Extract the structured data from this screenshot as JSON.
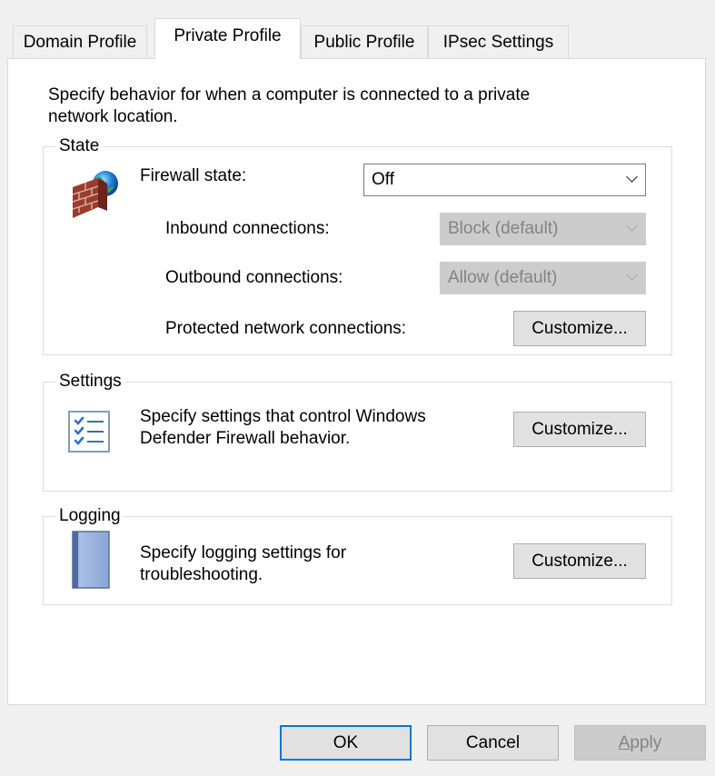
{
  "tabs": [
    {
      "label": "Domain Profile",
      "active": false
    },
    {
      "label": "Private Profile",
      "active": true
    },
    {
      "label": "Public Profile",
      "active": false
    },
    {
      "label": "IPsec Settings",
      "active": false
    }
  ],
  "description": {
    "line1": "Specify behavior for when a computer is connected to a private",
    "line2": "network location."
  },
  "state": {
    "legend": "State",
    "icon": "firewall-brick-globe-icon",
    "firewall_state_label": "Firewall state:",
    "firewall_state_value": "Off",
    "inbound_label": "Inbound connections:",
    "inbound_value": "Block (default)",
    "outbound_label": "Outbound connections:",
    "outbound_value": "Allow (default)",
    "protected_label": "Protected network connections:",
    "customize_label": "Customize..."
  },
  "settings": {
    "legend": "Settings",
    "icon": "checklist-icon",
    "line1": "Specify settings that control Windows",
    "line2": "Defender Firewall behavior.",
    "customize_label": "Customize..."
  },
  "logging": {
    "legend": "Logging",
    "icon": "notebook-icon",
    "line1": "Specify logging settings for",
    "line2": "troubleshooting.",
    "customize_label": "Customize..."
  },
  "buttons": {
    "ok": "OK",
    "cancel": "Cancel",
    "apply": "Apply"
  },
  "colors": {
    "accent": "#0078d7",
    "disabled_bg": "#cccccc",
    "disabled_text": "#838383"
  }
}
